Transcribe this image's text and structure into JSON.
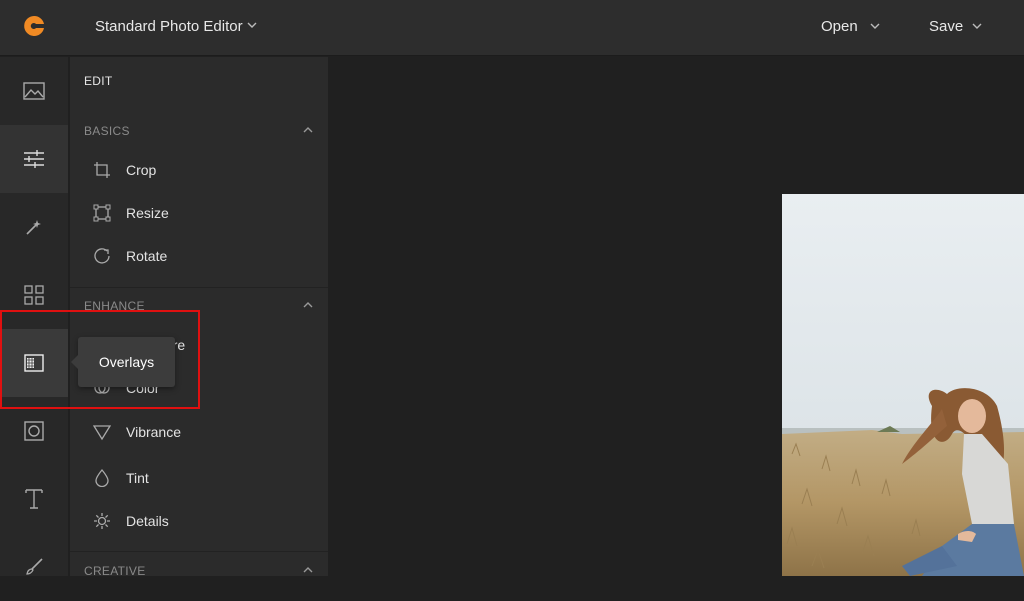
{
  "header": {
    "app_title": "Standard Photo Editor",
    "open_label": "Open",
    "save_label": "Save",
    "logo_color": "#f08a24"
  },
  "rail": {
    "items": [
      {
        "name": "image",
        "icon": "image-icon"
      },
      {
        "name": "edit",
        "icon": "sliders-icon",
        "active": true
      },
      {
        "name": "effects",
        "icon": "magic-wand-icon"
      },
      {
        "name": "frames",
        "icon": "grid-icon"
      },
      {
        "name": "overlays",
        "icon": "overlays-icon",
        "hovered": true
      },
      {
        "name": "vignette",
        "icon": "square-circle-icon"
      },
      {
        "name": "text",
        "icon": "text-icon"
      },
      {
        "name": "draw",
        "icon": "brush-icon"
      }
    ],
    "tooltip": "Overlays"
  },
  "panel": {
    "title": "EDIT",
    "basics": {
      "header": "BASICS",
      "tools": [
        {
          "label": "Crop",
          "icon": "crop-icon"
        },
        {
          "label": "Resize",
          "icon": "resize-icon"
        },
        {
          "label": "Rotate",
          "icon": "rotate-icon"
        }
      ]
    },
    "enhance": {
      "header": "ENHANCE",
      "tools": [
        {
          "label": "Exposure",
          "icon": "exposure-icon"
        },
        {
          "label": "Color",
          "icon": "color-icon"
        },
        {
          "label": "Vibrance",
          "icon": "vibrance-icon"
        },
        {
          "label": "Tint",
          "icon": "tint-icon"
        },
        {
          "label": "Details",
          "icon": "details-icon"
        }
      ]
    },
    "creative": {
      "header": "CREATIVE"
    }
  },
  "colors": {
    "highlight_box": "#e01010"
  }
}
